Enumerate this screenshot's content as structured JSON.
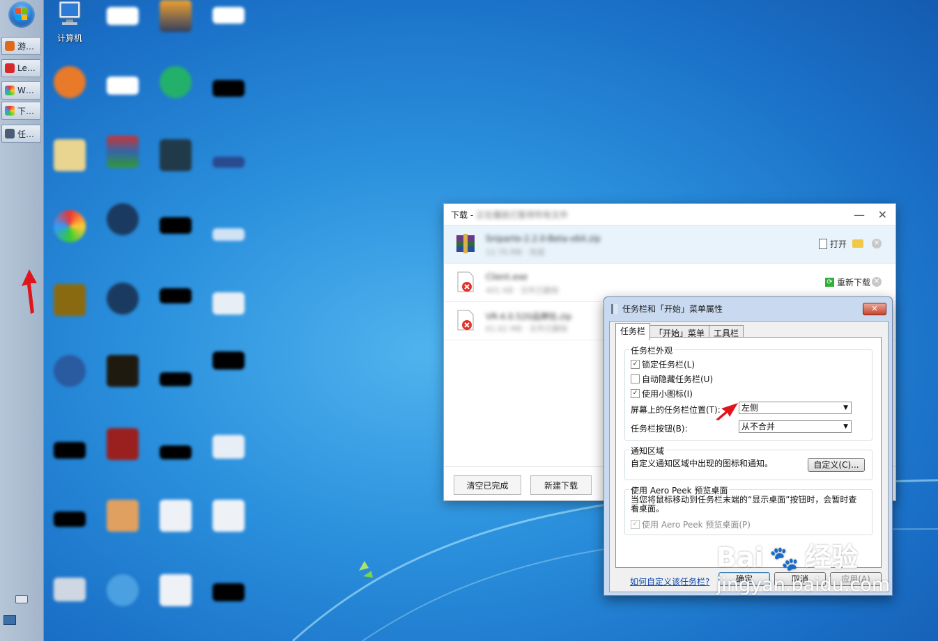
{
  "taskbar": {
    "buttons": [
      {
        "label": "游…",
        "color": "#e06a1b"
      },
      {
        "label": "Le…",
        "color": "#d9282b"
      },
      {
        "label": "W…",
        "color": "#7cbf3a"
      },
      {
        "label": "下…",
        "color": "#7cbf3a"
      },
      {
        "label": "任…",
        "color": "#4a5d75"
      }
    ]
  },
  "desktop": {
    "computer_label": "计算机"
  },
  "download_window": {
    "title_prefix": "下载 - ",
    "title_blurred": "正在播放已暂停所有文件",
    "files": [
      {
        "name": "Sniparte-2.2.0-Beta-x64.zip",
        "meta": "12.76 MB  ·  完成",
        "action": "打开"
      },
      {
        "name": "Client.exe",
        "meta": "401 KB  ·  文件已删除",
        "action": "重新下载"
      },
      {
        "name": "VR-4.0.520品牌包.zip",
        "meta": "61.62 MB  ·  文件已删除",
        "action": ""
      }
    ],
    "footer": {
      "clear_label": "清空已完成",
      "new_label": "新建下载"
    }
  },
  "dialog": {
    "title": "任务栏和「开始」菜单属性",
    "close_label": "✕",
    "tabs": [
      "任务栏",
      "「开始」菜单",
      "工具栏"
    ],
    "appearance": {
      "title": "任务栏外观",
      "lock_label": "锁定任务栏(L)",
      "autohide_label": "自动隐藏任务栏(U)",
      "small_icons_label": "使用小图标(I)",
      "position_label": "屏幕上的任务栏位置(T):",
      "position_value": "左侧",
      "buttons_label": "任务栏按钮(B):",
      "buttons_value": "从不合并"
    },
    "notify": {
      "title": "通知区域",
      "desc": "自定义通知区域中出现的图标和通知。",
      "customize_label": "自定义(C)..."
    },
    "peek": {
      "title": "使用 Aero Peek 预览桌面",
      "desc": "当您将鼠标移动到任务栏末端的“显示桌面”按钮时，会暂时查看桌面。",
      "checkbox_label": "使用 Aero Peek 预览桌面(P)"
    },
    "link": "如何自定义该任务栏?",
    "ok_label": "确定",
    "cancel_label": "取消",
    "apply_label": "应用(A)"
  },
  "watermark": {
    "brand": "Bai",
    "brand2": "经验",
    "url": "jingyan.baidu.com"
  },
  "colors": {
    "accent_red": "#e0151b",
    "link_blue": "#0645ad"
  }
}
